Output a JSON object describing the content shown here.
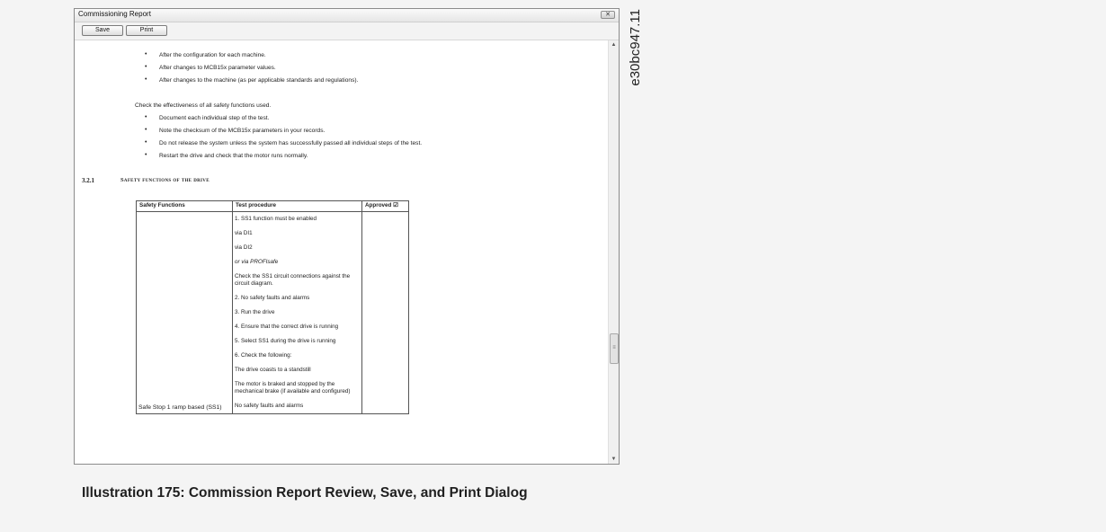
{
  "window": {
    "title": "Commissioning Report",
    "toolbar": {
      "save_label": "Save",
      "print_label": "Print"
    }
  },
  "content": {
    "bullets_top": [
      "After the configuration for each machine.",
      "After changes to MCB15x parameter values.",
      "After changes to the machine (as per applicable standards and regulations)."
    ],
    "check_text": "Check the effectiveness of all safety functions used.",
    "bullets_check": [
      "Document each individual step of the test.",
      "Note the checksum of the MCB15x parameters in your records.",
      "Do not release the system unless the system has successfully passed all individual steps of the test.",
      "Restart the drive and check that the motor runs normally."
    ],
    "section_number": "3.2.1",
    "section_title": "Safety functions of the drive",
    "table": {
      "headers": [
        "Safety Functions",
        "Test procedure",
        "Approved ☑"
      ],
      "safety_function": "Safe Stop 1 ramp based (SS1)",
      "steps": [
        "1. SS1 function must be enabled",
        "via DI1",
        "via DI2",
        "or via PROFIsafe",
        "Check the SS1 circuit connections against the circuit diagram.",
        "2. No safety faults and alarms",
        "3. Run the drive",
        "4. Ensure that the correct drive is running",
        "5. Select SS1 during the drive is running",
        "6. Check the following:",
        "The drive coasts to a standstill",
        "The motor is braked and stopped by the mechanical brake (if available and configured)",
        "No safety faults and alarms"
      ]
    }
  },
  "caption": "Illustration 175: Commission Report Review, Save, and Print Dialog",
  "side_code": "e30bc947.11"
}
